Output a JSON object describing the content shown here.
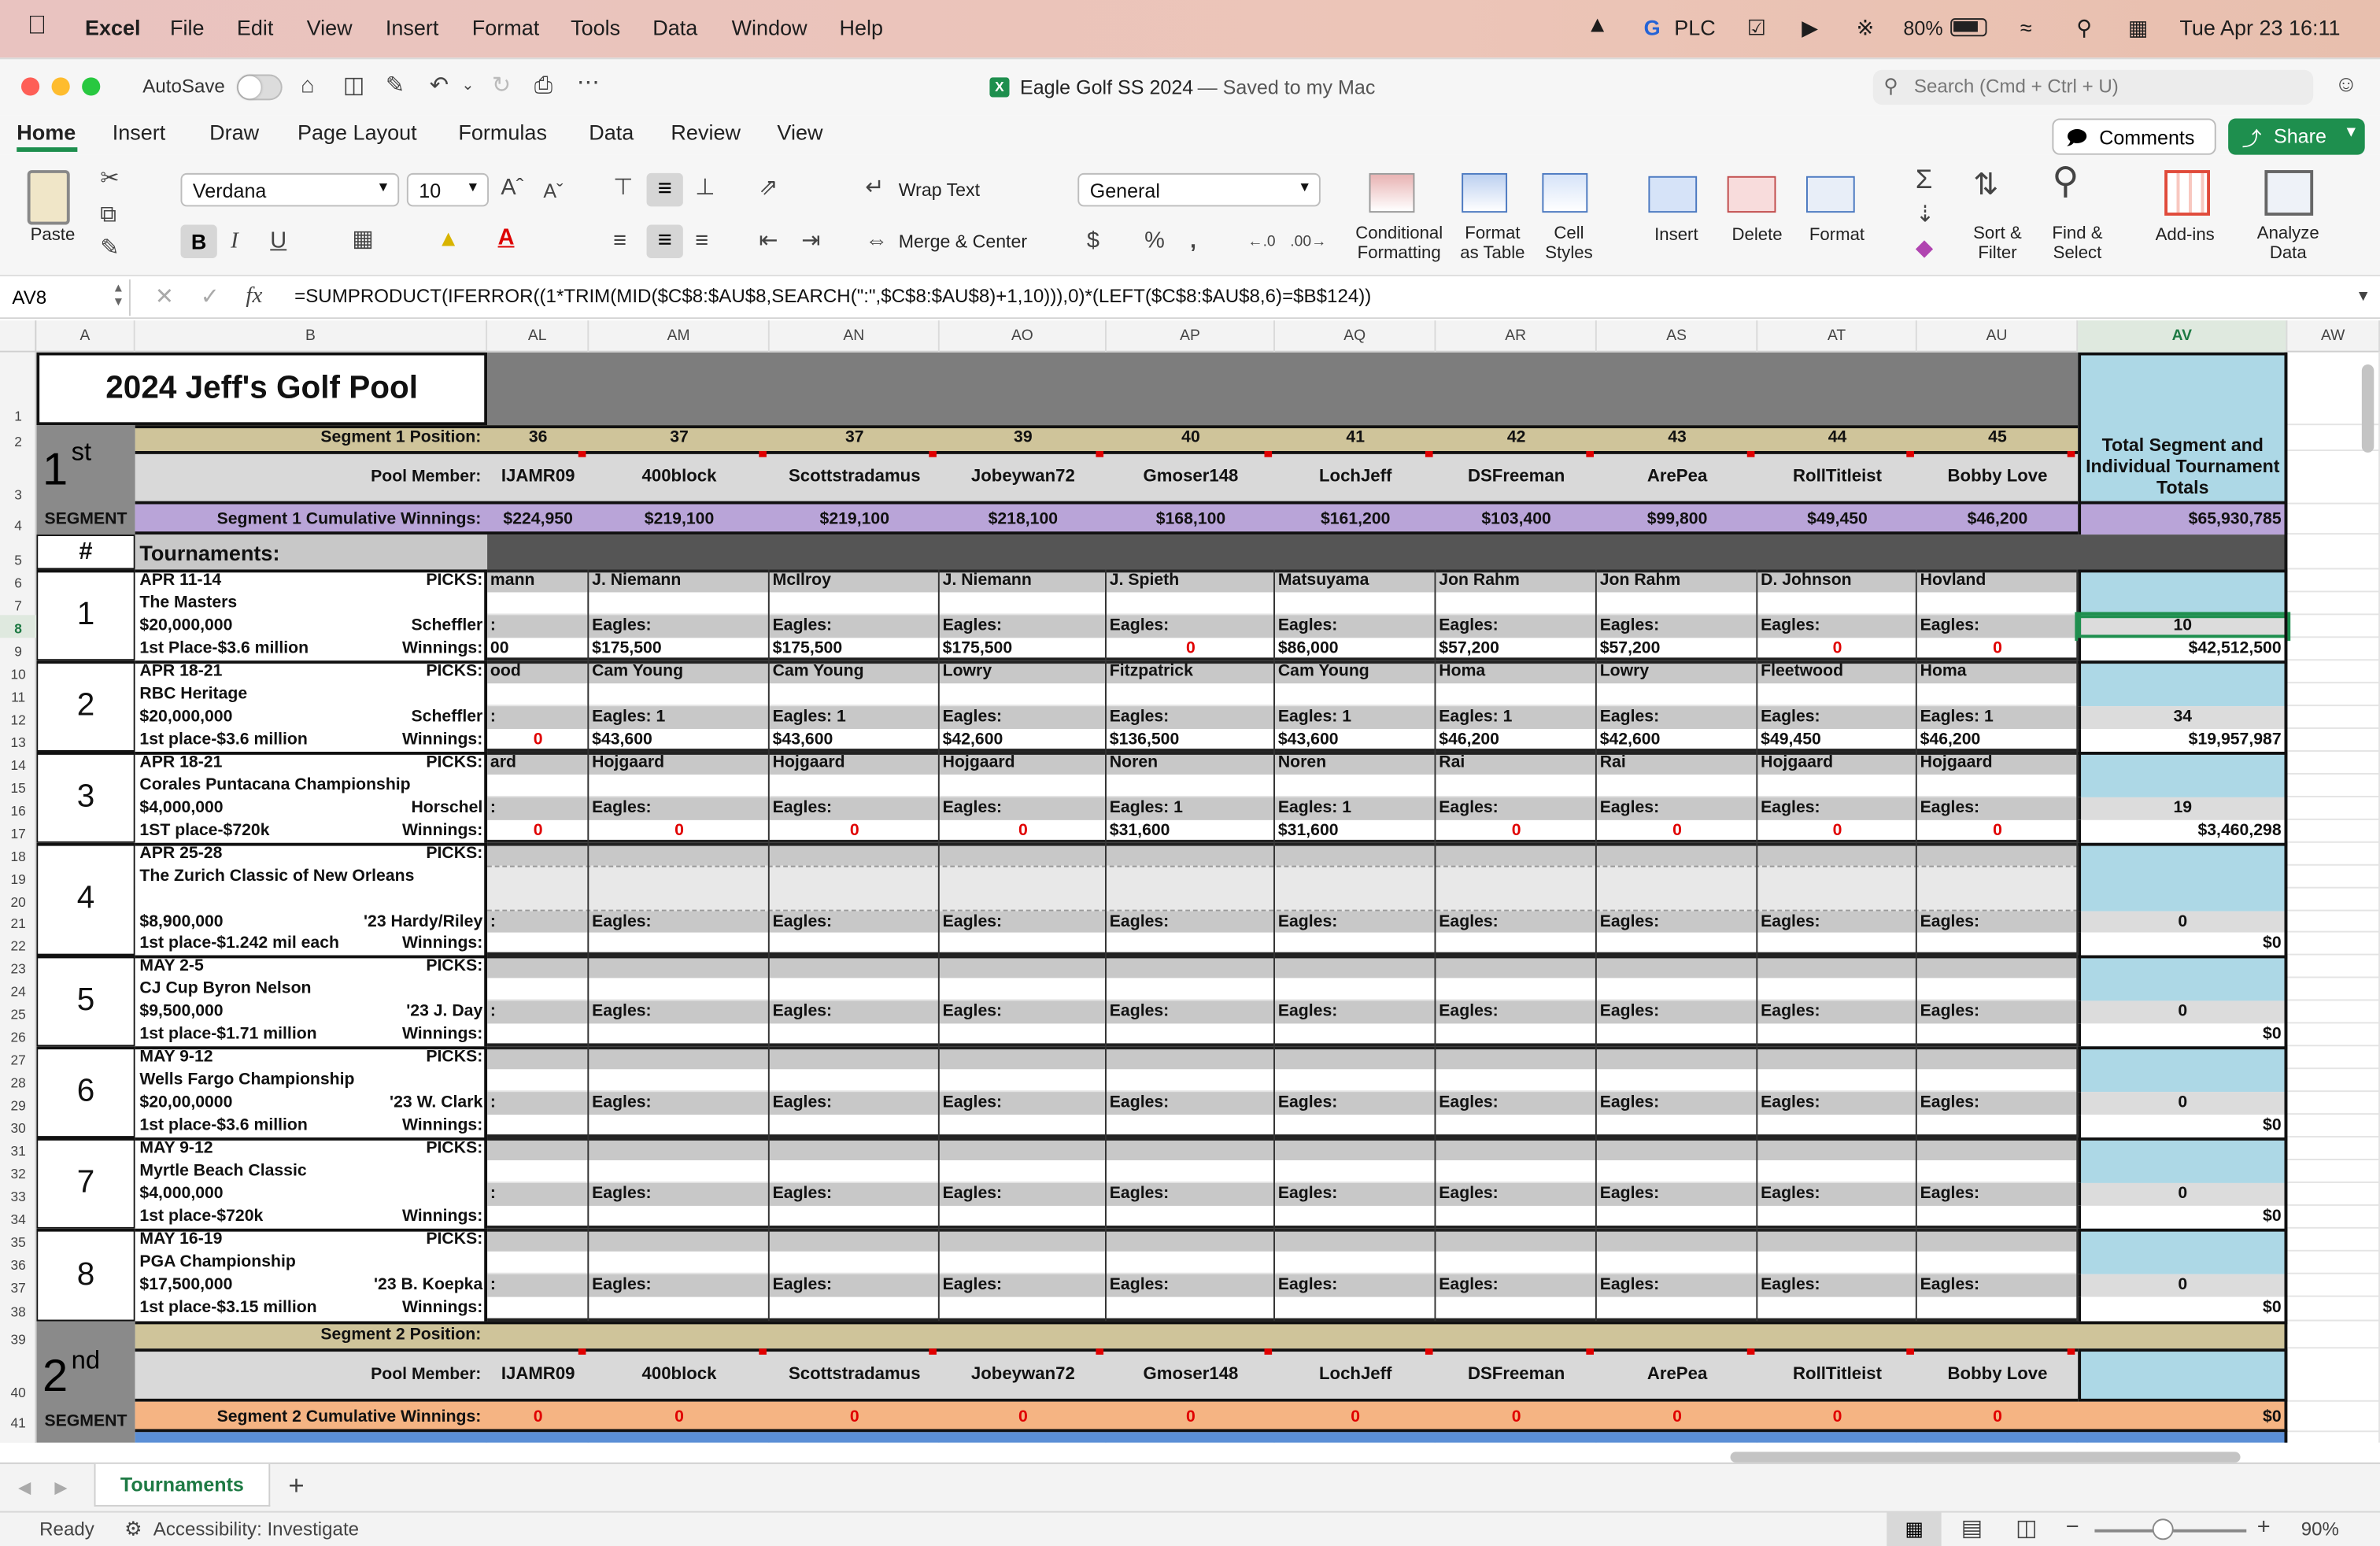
{
  "menubar": {
    "app": "Excel",
    "items": [
      "File",
      "Edit",
      "View",
      "Insert",
      "Format",
      "Tools",
      "Data",
      "Window",
      "Help"
    ],
    "plc": "PLC",
    "battery": "80%",
    "datetime": "Tue Apr 23  16:11"
  },
  "titlebar": {
    "autosave": "AutoSave",
    "doc_title": "Eagle Golf SS 2024",
    "doc_status": "— Saved to my Mac",
    "search_placeholder": "Search (Cmd + Ctrl + U)"
  },
  "ribbon_tabs": [
    "Home",
    "Insert",
    "Draw",
    "Page Layout",
    "Formulas",
    "Data",
    "Review",
    "View"
  ],
  "ribbon": {
    "comments": "Comments",
    "share": "Share",
    "paste": "Paste",
    "font_name": "Verdana",
    "font_size": "10",
    "wrap_text": "Wrap Text",
    "merge_center": "Merge & Center",
    "number_format": "General",
    "conditional": [
      "Conditional",
      "Formatting"
    ],
    "format_table": [
      "Format",
      "as Table"
    ],
    "cell_styles": [
      "Cell",
      "Styles"
    ],
    "insert": "Insert",
    "delete": "Delete",
    "format": "Format",
    "sort": [
      "Sort &",
      "Filter"
    ],
    "find": [
      "Find &",
      "Select"
    ],
    "addins": "Add-ins",
    "analyze": [
      "Analyze",
      "Data"
    ]
  },
  "formula_bar": {
    "cell_ref": "AV8",
    "formula": "=SUMPRODUCT(IFERROR((1*TRIM(MID($C$8:$AU$8,SEARCH(\":\",$C$8:$AU$8)+1,10))),0)*(LEFT($C$8:$AU$8,6)=$B$124))"
  },
  "columns": [
    "A",
    "B",
    "AL",
    "AM",
    "AN",
    "AO",
    "AP",
    "AQ",
    "AR",
    "AS",
    "AT",
    "AU",
    "AV",
    "AW"
  ],
  "rows": [
    "1",
    "2",
    "3",
    "4",
    "5",
    "6",
    "7",
    "8",
    "9",
    "10",
    "11",
    "12",
    "13",
    "14",
    "15",
    "16",
    "17",
    "18",
    "19",
    "20",
    "21",
    "22",
    "23",
    "24",
    "25",
    "26",
    "27",
    "28",
    "29",
    "30",
    "31",
    "32",
    "33",
    "34",
    "35",
    "36",
    "37",
    "38",
    "39",
    "40",
    "41"
  ],
  "sheet": {
    "title": "2024 Jeff's Golf Pool",
    "seg1_big": "1",
    "seg1_sup": "st",
    "seg1_label": "SEGMENT",
    "seg_position_label": "Segment 1 Position:",
    "pool_member_label": "Pool Member:",
    "seg1_cum_label": "Segment 1 Cumulative Winnings:",
    "hash": "#",
    "tournaments_label": "Tournaments:",
    "total_header": "Total Segment and Individual Tournament Totals",
    "total_cum": "$65,930,785",
    "positions": [
      "36",
      "37",
      "37",
      "39",
      "40",
      "41",
      "42",
      "43",
      "44",
      "45"
    ],
    "members": [
      "IJAMR09",
      "400block",
      "Scottstradamus",
      "Jobeywan72",
      "Gmoser148",
      "LochJeff",
      "DSFreeman",
      "ArePea",
      "RollTitleist",
      "Bobby Love"
    ],
    "cum_winnings": [
      "$224,950",
      "$219,100",
      "$219,100",
      "$218,100",
      "$168,100",
      "$161,200",
      "$103,400",
      "$99,800",
      "$49,450",
      "$46,200"
    ],
    "tournaments": [
      {
        "num": "1",
        "date": "APR 11-14",
        "name": "The Masters",
        "purse": "$20,000,000",
        "prev": "Scheffler",
        "first": "1st Place-$3.6 million",
        "picks": [
          "mann",
          "J. Niemann",
          "McIlroy",
          "J. Niemann",
          "J. Spieth",
          "Matsuyama",
          "Jon Rahm",
          "Jon Rahm",
          "D. Johnson",
          "Hovland"
        ],
        "eagles": [
          ":",
          "Eagles:",
          "Eagles:",
          "Eagles:",
          "Eagles:",
          "Eagles:",
          "Eagles:",
          "Eagles:",
          "Eagles:",
          "Eagles:"
        ],
        "wins": [
          "00",
          "$175,500",
          "$175,500",
          "$175,500",
          "0",
          "$86,000",
          "$57,200",
          "$57,200",
          "0",
          "0"
        ],
        "eagle_total": "10",
        "win_total": "$42,512,500"
      },
      {
        "num": "2",
        "date": "APR 18-21",
        "name": "RBC Heritage",
        "purse": "$20,000,000",
        "prev": "Scheffler",
        "first": "1st place-$3.6 million",
        "picks": [
          "ood",
          "Cam Young",
          "Cam Young",
          "Lowry",
          "Fitzpatrick",
          "Cam Young",
          "Homa",
          "Lowry",
          "Fleetwood",
          "Homa"
        ],
        "eagles": [
          ":",
          "Eagles: 1",
          "Eagles: 1",
          "Eagles:",
          "Eagles:",
          "Eagles: 1",
          "Eagles: 1",
          "Eagles:",
          "Eagles:",
          "Eagles: 1"
        ],
        "wins": [
          "0",
          "$43,600",
          "$43,600",
          "$42,600",
          "$136,500",
          "$43,600",
          "$46,200",
          "$42,600",
          "$49,450",
          "$46,200"
        ],
        "eagle_total": "34",
        "win_total": "$19,957,987"
      },
      {
        "num": "3",
        "date": "APR 18-21",
        "name": "Corales Puntacana Championship",
        "purse": "$4,000,000",
        "prev": "Horschel",
        "first": "1ST place-$720k",
        "picks": [
          "ard",
          "Hojgaard",
          "Hojgaard",
          "Hojgaard",
          "Noren",
          "Noren",
          "Rai",
          "Rai",
          "Hojgaard",
          "Hojgaard"
        ],
        "eagles": [
          ":",
          "Eagles:",
          "Eagles:",
          "Eagles:",
          "Eagles: 1",
          "Eagles: 1",
          "Eagles:",
          "Eagles:",
          "Eagles:",
          "Eagles:"
        ],
        "wins": [
          "0",
          "0",
          "0",
          "0",
          "$31,600",
          "$31,600",
          "0",
          "0",
          "0",
          "0"
        ],
        "eagle_total": "19",
        "win_total": "$3,460,298"
      },
      {
        "num": "4",
        "date": "APR 25-28",
        "name": "The Zurich Classic of New Orleans",
        "purse": "$8,900,000",
        "prev": "'23 Hardy/Riley",
        "first": "1st place-$1.242 mil each",
        "picks": [
          "",
          "",
          "",
          "",
          "",
          "",
          "",
          "",
          "",
          ""
        ],
        "eagles": [
          ":",
          "Eagles:",
          "Eagles:",
          "Eagles:",
          "Eagles:",
          "Eagles:",
          "Eagles:",
          "Eagles:",
          "Eagles:",
          "Eagles:"
        ],
        "wins": [
          "",
          "",
          "",
          "",
          "",
          "",
          "",
          "",
          "",
          ""
        ],
        "eagle_total": "0",
        "win_total": "$0"
      },
      {
        "num": "5",
        "date": "MAY 2-5",
        "name": "CJ Cup Byron Nelson",
        "purse": "$9,500,000",
        "prev": "'23 J. Day",
        "first": "1st place-$1.71 million",
        "picks": [
          "",
          "",
          "",
          "",
          "",
          "",
          "",
          "",
          "",
          ""
        ],
        "eagles": [
          ":",
          "Eagles:",
          "Eagles:",
          "Eagles:",
          "Eagles:",
          "Eagles:",
          "Eagles:",
          "Eagles:",
          "Eagles:",
          "Eagles:"
        ],
        "wins": [
          "",
          "",
          "",
          "",
          "",
          "",
          "",
          "",
          "",
          ""
        ],
        "eagle_total": "0",
        "win_total": "$0"
      },
      {
        "num": "6",
        "date": "MAY 9-12",
        "name": "Wells Fargo Championship",
        "purse": "$20,00,0000",
        "prev": "'23 W. Clark",
        "first": "1st place-$3.6 million",
        "picks": [
          "",
          "",
          "",
          "",
          "",
          "",
          "",
          "",
          "",
          ""
        ],
        "eagles": [
          ":",
          "Eagles:",
          "Eagles:",
          "Eagles:",
          "Eagles:",
          "Eagles:",
          "Eagles:",
          "Eagles:",
          "Eagles:",
          "Eagles:"
        ],
        "wins": [
          "",
          "",
          "",
          "",
          "",
          "",
          "",
          "",
          "",
          ""
        ],
        "eagle_total": "0",
        "win_total": "$0"
      },
      {
        "num": "7",
        "date": "MAY 9-12",
        "name": "Myrtle Beach Classic",
        "purse": "$4,000,000",
        "prev": "",
        "first": "1st place-$720k",
        "picks": [
          "",
          "",
          "",
          "",
          "",
          "",
          "",
          "",
          "",
          ""
        ],
        "eagles": [
          ":",
          "Eagles:",
          "Eagles:",
          "Eagles:",
          "Eagles:",
          "Eagles:",
          "Eagles:",
          "Eagles:",
          "Eagles:",
          "Eagles:"
        ],
        "wins": [
          "",
          "",
          "",
          "",
          "",
          "",
          "",
          "",
          "",
          ""
        ],
        "eagle_total": "0",
        "win_total": "$0"
      },
      {
        "num": "8",
        "date": "MAY 16-19",
        "name": "PGA Championship",
        "purse": "$17,500,000",
        "prev": "'23 B. Koepka",
        "first": "1st place-$3.15 million",
        "picks": [
          "",
          "",
          "",
          "",
          "",
          "",
          "",
          "",
          "",
          ""
        ],
        "eagles": [
          ":",
          "Eagles:",
          "Eagles:",
          "Eagles:",
          "Eagles:",
          "Eagles:",
          "Eagles:",
          "Eagles:",
          "Eagles:",
          "Eagles:"
        ],
        "wins": [
          "",
          "",
          "",
          "",
          "",
          "",
          "",
          "",
          "",
          ""
        ],
        "eagle_total": "0",
        "win_total": "$0"
      }
    ],
    "picks_label": "PICKS:",
    "winnings_label": "Winnings:",
    "seg2_position_label": "Segment 2 Position:",
    "seg2_big": "2",
    "seg2_sup": "nd",
    "seg2_label": "SEGMENT",
    "seg2_members": [
      "IJAMR09",
      "400block",
      "Scottstradamus",
      "Jobeywan72",
      "Gmoser148",
      "LochJeff",
      "DSFreeman",
      "ArePea",
      "RollTitleist",
      "Bobby Love"
    ],
    "seg2_cum_label": "Segment 2 Cumulative Winnings:",
    "seg2_cum": [
      "0",
      "0",
      "0",
      "0",
      "0",
      "0",
      "0",
      "0",
      "0",
      "0"
    ],
    "seg2_total": "$0"
  },
  "sheet_tabs": {
    "active": "Tournaments",
    "add": "+"
  },
  "status": {
    "ready": "Ready",
    "accessibility": "Accessibility: Investigate",
    "zoom": "90%"
  },
  "colors": {
    "tan": "#cfc49a",
    "purple": "#b9a4d8",
    "lightblue": "#add8e6",
    "gray": "#c8c8c8",
    "darkgray": "#7d7d7d",
    "orange": "#f5b483",
    "blue": "#5b8fd6",
    "green": "#1e8f4e",
    "red": "#e00000"
  }
}
